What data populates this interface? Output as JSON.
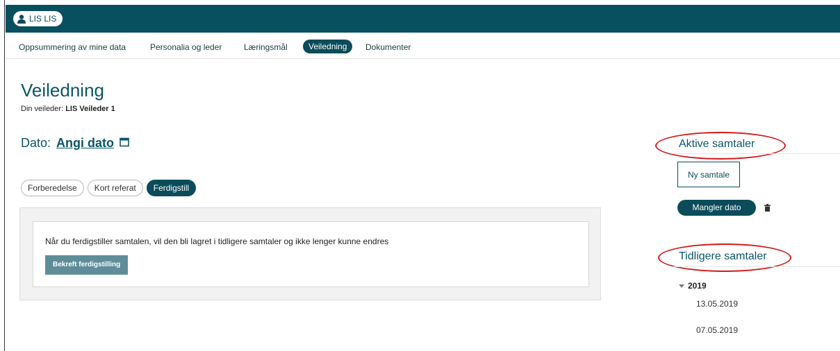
{
  "topbar": {
    "user_label": "LIS LIS"
  },
  "nav": {
    "items": [
      {
        "label": "Oppsummering av mine data"
      },
      {
        "label": "Personalia og leder"
      },
      {
        "label": "Læringsmål"
      },
      {
        "label": "Veiledning"
      },
      {
        "label": "Dokumenter"
      }
    ],
    "active": "Veiledning"
  },
  "page": {
    "title": "Veiledning",
    "supervisor_prefix": "Din veileder:",
    "supervisor_name": "LIS Veileder 1"
  },
  "date": {
    "label": "Dato:",
    "link": "Angi dato"
  },
  "tabs": [
    {
      "label": "Forberedelse"
    },
    {
      "label": "Kort referat"
    },
    {
      "label": "Ferdigstill"
    }
  ],
  "finalize": {
    "notice": "Når du ferdigstiller samtalen, vil den bli lagret i tidligere samtaler og ikke lenger kunne endres",
    "confirm_label": "Bekreft ferdigstilling"
  },
  "active_conversations": {
    "heading": "Aktive samtaler",
    "new_label": "Ny samtale",
    "items": [
      {
        "label": "Mangler dato"
      }
    ]
  },
  "previous_conversations": {
    "heading": "Tidligere samtaler",
    "years": [
      {
        "year": "2019",
        "dates": [
          "13.05.2019",
          "07.05.2019"
        ]
      }
    ]
  },
  "colors": {
    "brand": "#08505f",
    "accent": "#0b4b5a",
    "confirm": "#5e8d99",
    "annotation": "#d21a1a"
  }
}
